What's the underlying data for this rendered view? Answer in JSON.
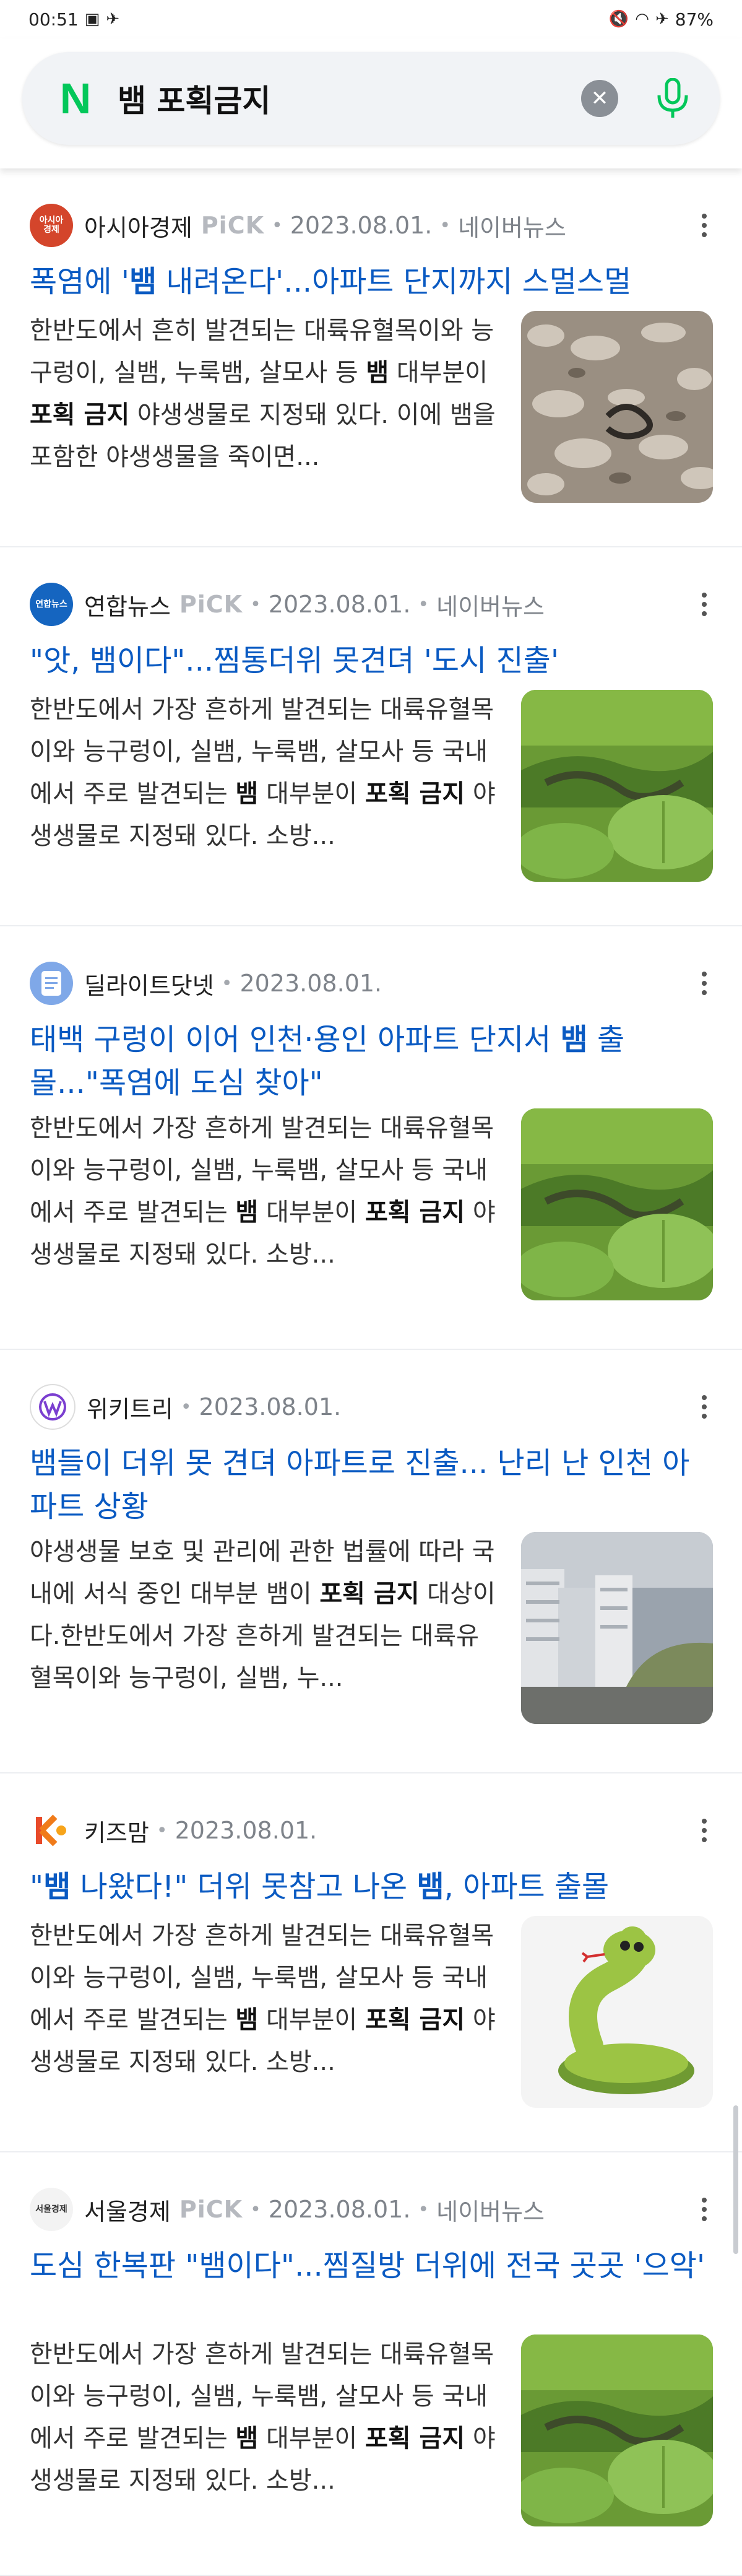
{
  "status_bar": {
    "time": "00:51",
    "battery": "87%"
  },
  "search": {
    "query": "뱀 포획금지",
    "logo": "N",
    "clear_icon": "close-icon",
    "mic_icon": "mic-icon",
    "accent": "#03c75a"
  },
  "results": [
    {
      "source": "아시아경제",
      "pick": "PiCK",
      "date": "2023.08.01.",
      "press": "네이버뉴스",
      "logo_text": "아시아\n경제",
      "logo_color": "#d4452b",
      "title_parts": [
        "폭염에 '",
        "뱀",
        " 내려온다'...아파트 단지까지 스멀스멀"
      ],
      "snippet_parts": [
        "한반도에서 흔히 발견되는 대륙유혈목이와 능구렁이, 실뱀, 누룩뱀, 살모사 등 ",
        "뱀",
        " 대부분이 ",
        "포획 금지",
        " 야생생물로 지정돼 있다. 이에 뱀을 포함한 야생생물을 죽이면..."
      ],
      "thumb": "rocks"
    },
    {
      "source": "연합뉴스",
      "pick": "PiCK",
      "date": "2023.08.01.",
      "press": "네이버뉴스",
      "logo_text": "연합뉴스",
      "logo_color": "#1565c0",
      "title_parts": [
        "\"앗, 뱀이다\"...찜통더위 못견뎌 '도시 진출'"
      ],
      "snippet_parts": [
        "한반도에서 가장 흔하게 발견되는 대륙유혈목이와 능구렁이, 실뱀, 누룩뱀, 살모사 등 국내에서 주로 발견되는 ",
        "뱀",
        " 대부분이 ",
        "포획 금지",
        " 야생생물로 지정돼 있다. 소방..."
      ],
      "thumb": "leaves"
    },
    {
      "source": "딜라이트닷넷",
      "pick": "",
      "date": "2023.08.01.",
      "press": "",
      "logo_text": "doc",
      "logo_color": "#7fa8e8",
      "title_parts": [
        "태백 구렁이 이어 인천·용인 아파트 단지서 ",
        "뱀",
        " 출몰...\"폭염에 도심 찾아\""
      ],
      "snippet_parts": [
        "한반도에서 가장 흔하게 발견되는 대륙유혈목이와 능구렁이, 실뱀, 누룩뱀, 살모사 등 국내에서 주로 발견되는 ",
        "뱀",
        " 대부분이 ",
        "포획 금지",
        " 야생생물로 지정돼 있다. 소방..."
      ],
      "thumb": "leaves"
    },
    {
      "source": "위키트리",
      "pick": "",
      "date": "2023.08.01.",
      "press": "",
      "logo_text": "W",
      "logo_color": "#ffffff",
      "title_parts": [
        "뱀들이 더위 못 견뎌 아파트로 진출... 난리 난 인천 아파트 상황"
      ],
      "snippet_parts": [
        "야생생물 보호 및 관리에 관한 법률에 따라 국내에 서식 중인 대부분 뱀이 ",
        "포획 금지",
        " 대상이다.한반도에서 가장 흔하게 발견되는 대륙유혈목이와 능구렁이, 실뱀, 누..."
      ],
      "thumb": "apartments"
    },
    {
      "source": "키즈맘",
      "pick": "",
      "date": "2023.08.01.",
      "press": "",
      "logo_text": "K",
      "logo_color": "#ffffff",
      "title_parts": [
        "\"",
        "뱀",
        " 나왔다!\" 더위 못참고 나온 ",
        "뱀",
        ", 아파트 출몰"
      ],
      "snippet_parts": [
        "한반도에서 가장 흔하게 발견되는 대륙유혈목이와 능구렁이, 실뱀, 누룩뱀, 살모사 등 국내에서 주로 발견되는 ",
        "뱀",
        " 대부분이 ",
        "포획 금지",
        " 야생생물로 지정돼 있다. 소방..."
      ],
      "thumb": "cartoon-snake"
    },
    {
      "source": "서울경제",
      "pick": "PiCK",
      "date": "2023.08.01.",
      "press": "네이버뉴스",
      "logo_text": "서울경제",
      "logo_color": "#f3f3f3",
      "title_parts": [
        "도심 한복판 \"뱀이다\"...찜질방 더위에 전국 곳곳 '으악'"
      ],
      "snippet_parts": [
        "한반도에서 가장 흔하게 발견되는 대륙유혈목이와 능구렁이, 실뱀, 누룩뱀, 살모사 등 국내에서 주로 발견되는 ",
        "뱀",
        " 대부분이 ",
        "포획 금지",
        " 야생생물로 지정돼 있다. 소방..."
      ],
      "thumb": "leaves"
    }
  ]
}
